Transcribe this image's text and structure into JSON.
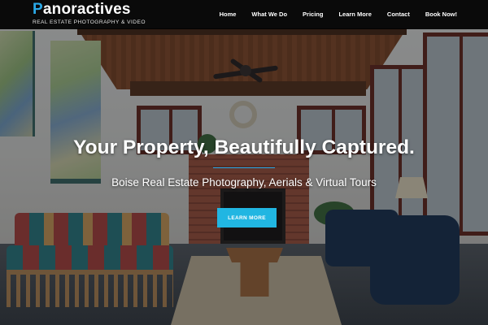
{
  "brand": {
    "name_first_letter": "P",
    "name_rest": "anoractives",
    "tagline": "REAL ESTATE PHOTOGRAPHY & VIDEO",
    "accent_color": "#2aa9e8"
  },
  "nav": {
    "items": [
      {
        "label": "Home"
      },
      {
        "label": "What We Do"
      },
      {
        "label": "Pricing"
      },
      {
        "label": "Learn More"
      },
      {
        "label": "Contact"
      },
      {
        "label": "Book Now!"
      }
    ]
  },
  "hero": {
    "title": "Your Property, Beautifully Captured.",
    "subtitle": "Boise Real Estate Photography, Aerials & Virtual Tours",
    "cta_label": "LEARN MORE",
    "cta_color": "#21b6e2"
  }
}
